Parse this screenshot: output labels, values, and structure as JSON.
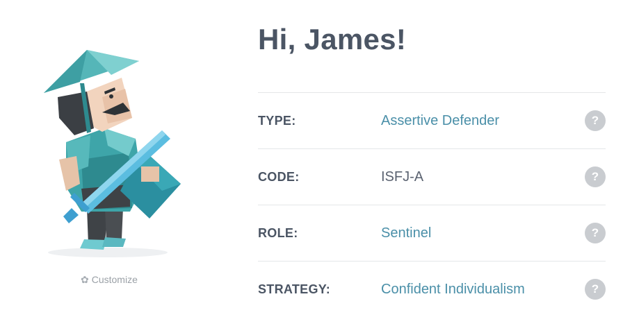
{
  "avatar": {
    "customize_label": "Customize",
    "icon": "gear-icon"
  },
  "greeting": "Hi, James!",
  "rows": [
    {
      "label": "TYPE:",
      "value": "Assertive Defender",
      "link": true
    },
    {
      "label": "CODE:",
      "value": "ISFJ-A",
      "link": false
    },
    {
      "label": "ROLE:",
      "value": "Sentinel",
      "link": true
    },
    {
      "label": "STRATEGY:",
      "value": "Confident Individualism",
      "link": true
    }
  ],
  "help_glyph": "?",
  "colors": {
    "heading": "#4b5564",
    "link": "#4a8fa8",
    "help_bg": "#c9ccd0",
    "divider": "#e4e6e8"
  }
}
